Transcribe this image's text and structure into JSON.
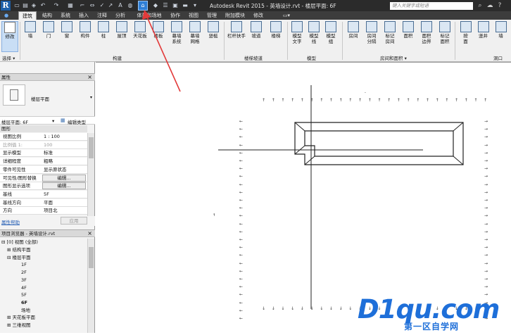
{
  "titlebar": {
    "logo": "R",
    "title": "Autodesk Revit 2015 -   英墙设计.rvt - 楼层平面: 6F",
    "search_placeholder": "键入关键字或短语"
  },
  "tabs": [
    "建筑",
    "结构",
    "系统",
    "插入",
    "注释",
    "分析",
    "体量和场地",
    "协作",
    "视图",
    "管理",
    "附加模块",
    "修改"
  ],
  "ribbon": {
    "modify": "修改",
    "select_label": "选择 ▾",
    "build": [
      {
        "label": "墙",
        "icon": "wall-icon"
      },
      {
        "label": "门",
        "icon": "door-icon"
      },
      {
        "label": "窗",
        "icon": "window-icon"
      },
      {
        "label": "构件",
        "icon": "component-icon"
      },
      {
        "label": "柱",
        "icon": "column-icon"
      },
      {
        "label": "屋顶",
        "icon": "roof-icon"
      },
      {
        "label": "天花板",
        "icon": "ceiling-icon"
      },
      {
        "label": "楼板",
        "icon": "floor-icon"
      },
      {
        "label": "幕墙\n系统",
        "icon": "curtain-system-icon"
      },
      {
        "label": "幕墙\n网格",
        "icon": "curtain-grid-icon"
      },
      {
        "label": "竖梃",
        "icon": "mullion-icon"
      }
    ],
    "build_panel": "构建",
    "circulation": [
      {
        "label": "栏杆扶手",
        "icon": "railing-icon"
      },
      {
        "label": "坡道",
        "icon": "ramp-icon"
      },
      {
        "label": "楼梯",
        "icon": "stair-icon"
      }
    ],
    "circulation_panel": "楼梯坡道",
    "model": [
      {
        "label": "模型\n文字",
        "icon": "model-text-icon"
      },
      {
        "label": "模型\n线",
        "icon": "model-line-icon"
      },
      {
        "label": "模型\n组",
        "icon": "model-group-icon"
      }
    ],
    "model_panel": "模型",
    "room": [
      {
        "label": "房间",
        "icon": "room-icon"
      },
      {
        "label": "房间\n分隔",
        "icon": "room-separator-icon"
      },
      {
        "label": "标记\n房间",
        "icon": "tag-room-icon"
      },
      {
        "label": "面积",
        "icon": "area-icon"
      },
      {
        "label": "面积\n边界",
        "icon": "area-boundary-icon"
      },
      {
        "label": "标记\n面积",
        "icon": "tag-area-icon"
      }
    ],
    "room_panel": "房间和面积 ▾",
    "opening": [
      {
        "label": "按\n面",
        "icon": "by-face-icon"
      },
      {
        "label": "竖井",
        "icon": "shaft-icon"
      },
      {
        "label": "墙",
        "icon": "wall-opening-icon"
      }
    ],
    "opening_panel": "洞口"
  },
  "properties": {
    "title": "属性",
    "close": "×",
    "type_name": "楼层平面",
    "selector": "楼层平面: 6F",
    "edit_type": "编辑类型",
    "section": "图形",
    "rows": [
      {
        "k": "视图比例",
        "v": "1 : 100"
      },
      {
        "k": "比例值 1:",
        "v": "100"
      },
      {
        "k": "显示模型",
        "v": "标准"
      },
      {
        "k": "详细程度",
        "v": "粗略"
      },
      {
        "k": "零件可见性",
        "v": "显示原状态"
      },
      {
        "k": "可见性/图形替换",
        "v": "编辑..."
      },
      {
        "k": "图形显示选项",
        "v": "编辑..."
      },
      {
        "k": "基线",
        "v": "5F"
      },
      {
        "k": "基线方向",
        "v": "平面"
      },
      {
        "k": "方向",
        "v": "项目北"
      }
    ],
    "help": "属性帮助",
    "apply": "应用"
  },
  "browser": {
    "title": "项目浏览器 - 英墙设计.rvt",
    "close": "×",
    "root": "[0] 视图 (全部)",
    "items": [
      {
        "label": "结构平面",
        "level": 1,
        "toggle": "⊞"
      },
      {
        "label": "楼层平面",
        "level": 1,
        "toggle": "⊟"
      },
      {
        "label": "1F",
        "level": 2
      },
      {
        "label": "2F",
        "level": 2
      },
      {
        "label": "3F",
        "level": 2
      },
      {
        "label": "4F",
        "level": 2
      },
      {
        "label": "5F",
        "level": 2
      },
      {
        "label": "6F",
        "level": 2,
        "bold": true
      },
      {
        "label": "场地",
        "level": 2
      },
      {
        "label": "天花板平面",
        "level": 1,
        "toggle": "⊞"
      },
      {
        "label": "三维视图",
        "level": 1,
        "toggle": "⊞"
      }
    ]
  },
  "canvas": {
    "north_label": "-",
    "cursor_mark": "↑"
  },
  "watermark": {
    "main": "D1qu.com",
    "sub": "第一区自学网"
  }
}
